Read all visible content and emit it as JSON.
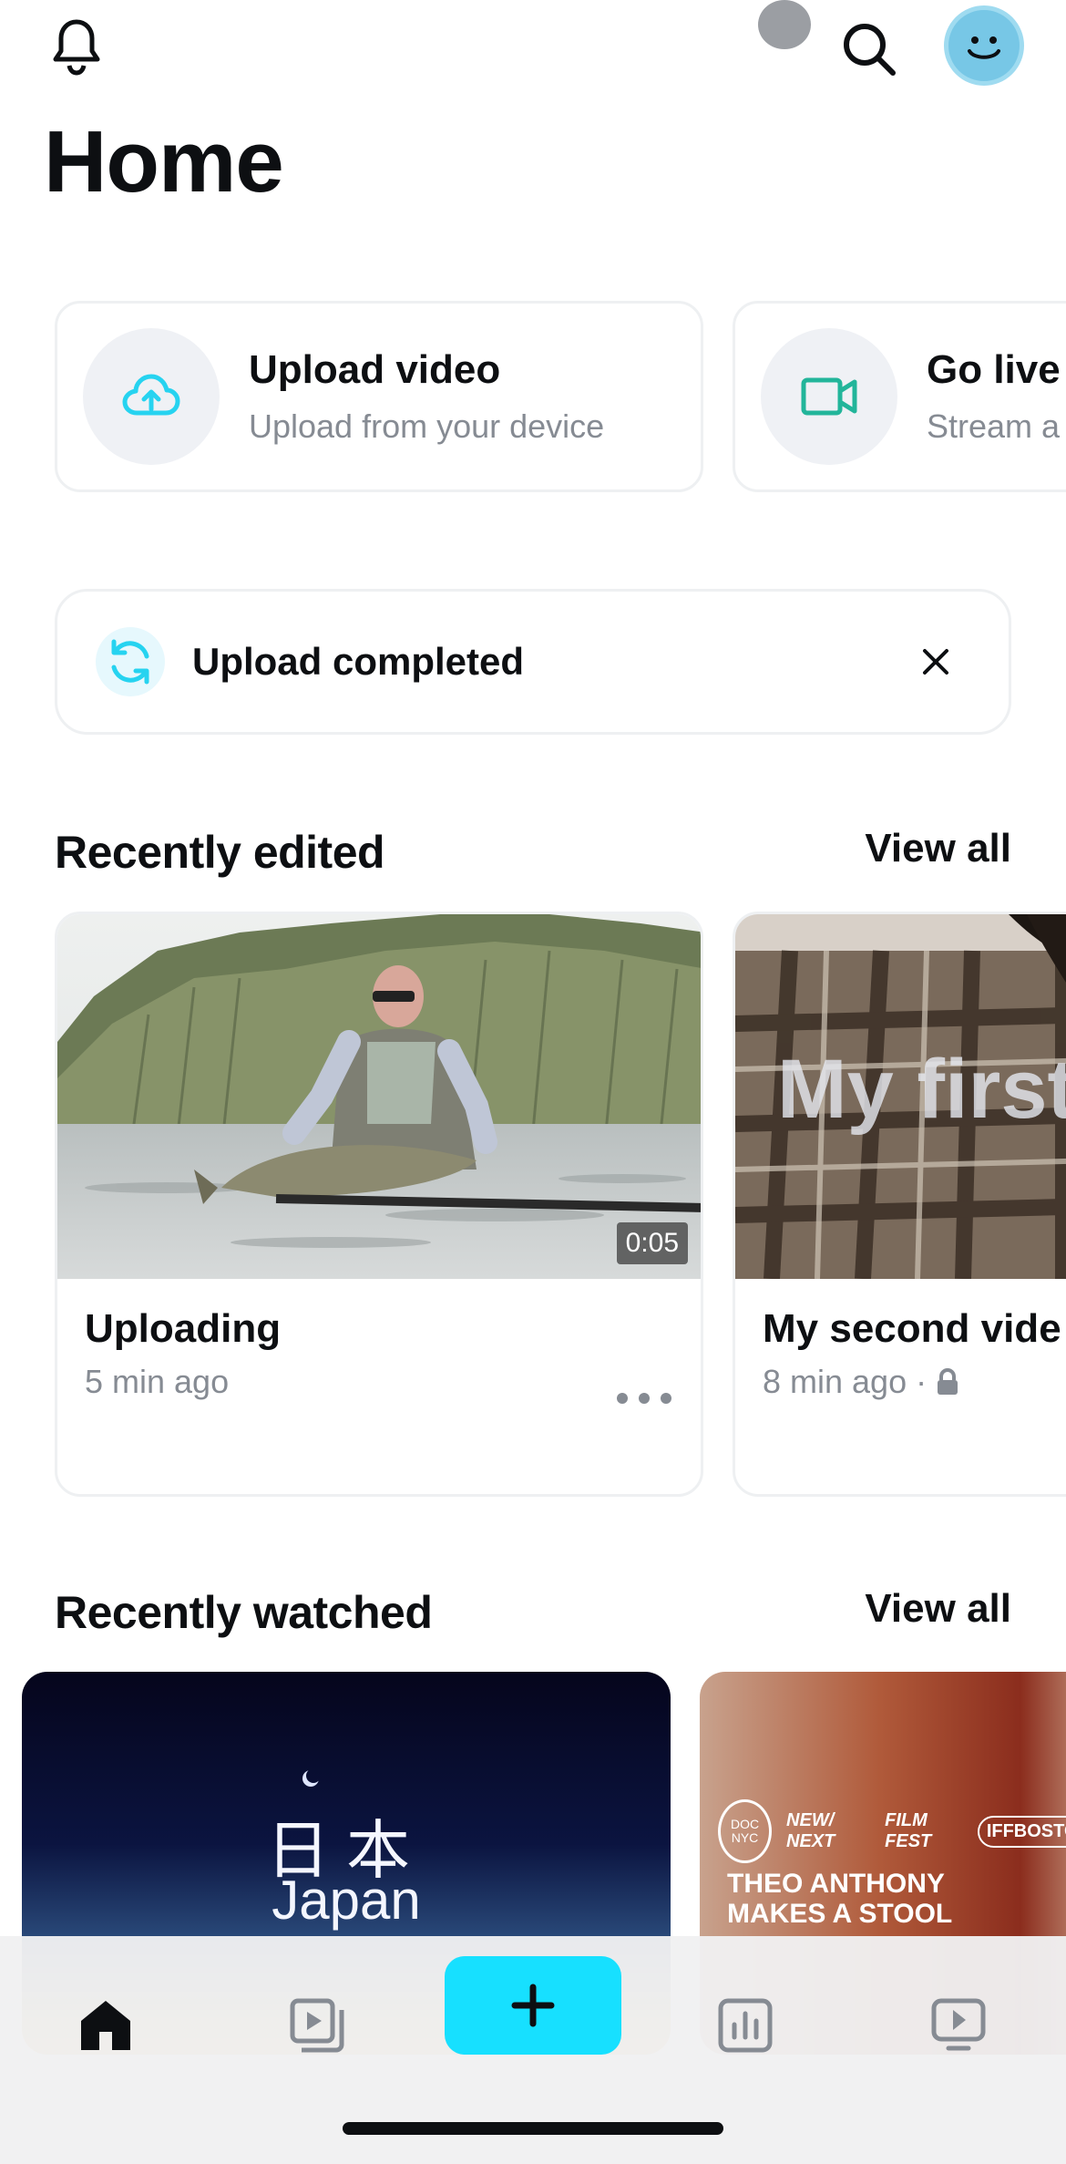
{
  "header": {
    "title": "Home",
    "notification_icon": "bell-icon",
    "search_icon": "search-icon",
    "avatar_icon": "smiley-avatar"
  },
  "actions": [
    {
      "title": "Upload video",
      "subtitle": "Upload from your device",
      "icon": "upload-cloud-icon",
      "accent": "#26d3f0"
    },
    {
      "title": "Go live",
      "subtitle": "Stream a",
      "icon": "video-camera-icon",
      "accent": "#22b59a"
    }
  ],
  "toast": {
    "text": "Upload completed",
    "icon": "sync-icon",
    "close_icon": "close-icon"
  },
  "recently_edited": {
    "title": "Recently edited",
    "view_all": "View all",
    "items": [
      {
        "title": "Uploading",
        "meta": "5 min ago",
        "duration": "0:05"
      },
      {
        "title": "My second vide",
        "meta": "8 min ago ·",
        "overlay": "My first"
      }
    ]
  },
  "recently_watched": {
    "title": "Recently watched",
    "view_all": "View all",
    "items": [
      {
        "kanji": "日本",
        "subtitle": "Japan"
      },
      {
        "laurels": [
          "DOC NYC",
          "NEW/ NEXT",
          "FILM FEST",
          "IFFBOSTON"
        ],
        "title_line1": "THEO ANTHONY",
        "title_line2": "MAKES A STOOL"
      }
    ]
  },
  "tabbar": {
    "tabs": [
      "home-icon",
      "library-icon",
      "create-plus-icon",
      "analytics-icon",
      "player-icon"
    ],
    "accent": "#17e0ff"
  }
}
